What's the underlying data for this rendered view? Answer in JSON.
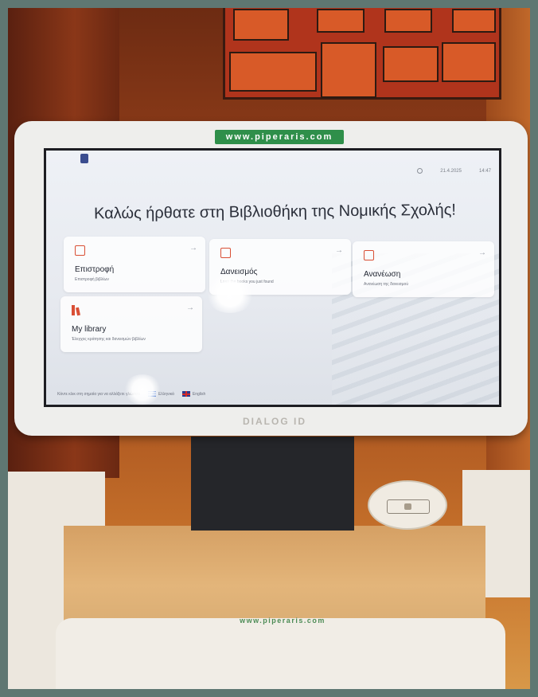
{
  "hardware": {
    "brand_tag": "www.piperaris.com",
    "bezel_logo": "DIALOG ID",
    "desk_brand": "www.piperaris.com"
  },
  "screen": {
    "status": {
      "date": "21.4.2025",
      "time": "14:47"
    },
    "welcome": "Καλώς ήρθατε στη Βιβλιοθήκη της Νομικής Σχολής!",
    "cards": [
      {
        "title": "Επιστροφή",
        "subtitle": "Επιστροφή βιβλίων",
        "icon": "return-book-icon"
      },
      {
        "title": "Δανεισμός",
        "subtitle": "Loan the books you just found",
        "icon": "loan-book-icon"
      },
      {
        "title": "Ανανέωση",
        "subtitle": "Ανανέωση της δανεισμού",
        "icon": "renew-book-icon"
      },
      {
        "title": "My library",
        "subtitle": "Έλεγχος κράτησης και δανεισμών βιβλίων",
        "icon": "books-icon"
      }
    ],
    "footer": {
      "hint": "Κάντε κλικ στη σημαία για να αλλάξετε γλώσσα",
      "lang_greek": "Ελληνικά",
      "lang_english": "English"
    }
  },
  "colors": {
    "accent": "#d94f35",
    "brand_green": "#2f8f4a"
  }
}
